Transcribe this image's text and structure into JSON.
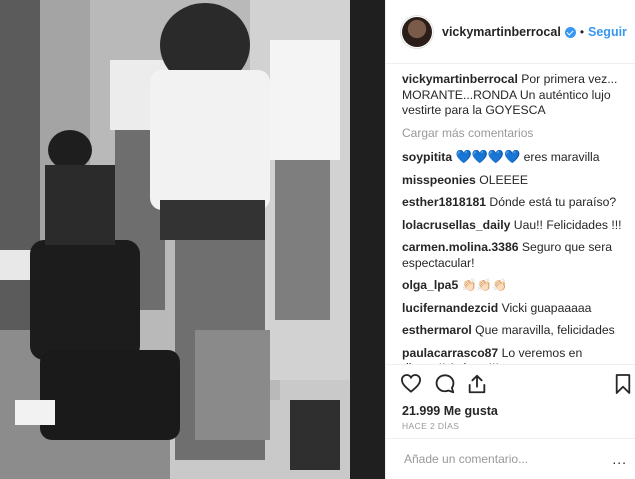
{
  "header": {
    "username": "vickymartinberrocal",
    "separator": "•",
    "follow_label": "Seguir",
    "more_icon": "..."
  },
  "caption": {
    "username": "vickymartinberrocal",
    "text": "Por primera vez... MORANTE...RONDA Un auténtico lujo vestirte para la GOYESCA"
  },
  "load_more_label": "Cargar más comentarios",
  "comments": [
    {
      "user": "soypitita",
      "text": "eres maravilla",
      "hearts": "💙💙💙💙"
    },
    {
      "user": "misspeonies",
      "text": "OLEEEE"
    },
    {
      "user": "esther1818181",
      "text": "Dónde está tu paraíso?"
    },
    {
      "user": "lolacrusellas_daily",
      "text": "Uau!! Felicidades !!!"
    },
    {
      "user": "carmen.molina.3386",
      "text": "Seguro que sera espectacular!"
    },
    {
      "user": "olga_lpa5",
      "text": "👏🏻👏🏻👏🏻"
    },
    {
      "user": "lucifernandezcid",
      "text": "Vicki guapaaaaa"
    },
    {
      "user": "esthermarol",
      "text": "Que maravilla, felicidades"
    },
    {
      "user": "paulacarrasco87",
      "text": "Lo veremos en directo!! Artistas!!!"
    }
  ],
  "likes": "21.999 Me gusta",
  "timestamp": "HACE 2 DÍAS",
  "add_comment_placeholder": "Añade un comentario...",
  "colors": {
    "accent": "#3897f0",
    "muted": "#999999",
    "border": "#efefef"
  },
  "icons": [
    "heart-icon",
    "comment-icon",
    "share-icon",
    "bookmark-icon",
    "verified-badge-icon"
  ]
}
